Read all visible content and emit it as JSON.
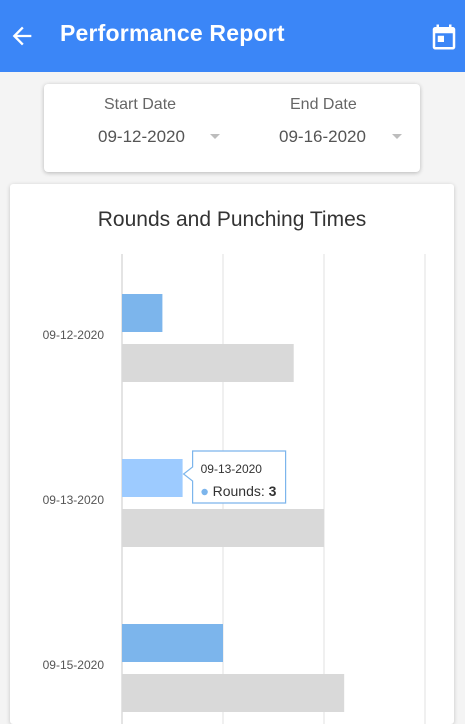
{
  "appbar": {
    "title": "Performance Report",
    "back_icon": "arrow-back-icon",
    "calendar_icon": "calendar-icon",
    "color": "#3b86f7"
  },
  "date_range": {
    "start_label": "Start Date",
    "start_value": "09-12-2020",
    "end_label": "End Date",
    "end_value": "09-16-2020"
  },
  "chart_data": {
    "type": "bar",
    "orientation": "horizontal",
    "title": "Rounds and Punching Times",
    "categories": [
      "09-12-2020",
      "09-13-2020",
      "09-15-2020"
    ],
    "series": [
      {
        "name": "Rounds",
        "values": [
          2,
          3,
          5
        ],
        "color": "#7cb5ec"
      },
      {
        "values": [
          8.5,
          10,
          11
        ],
        "color": "#d9d9d9"
      }
    ],
    "xlim": [
      0,
      15
    ],
    "grid": true,
    "tooltip": {
      "category": "09-13-2020",
      "series": "Rounds",
      "value": "3"
    }
  }
}
